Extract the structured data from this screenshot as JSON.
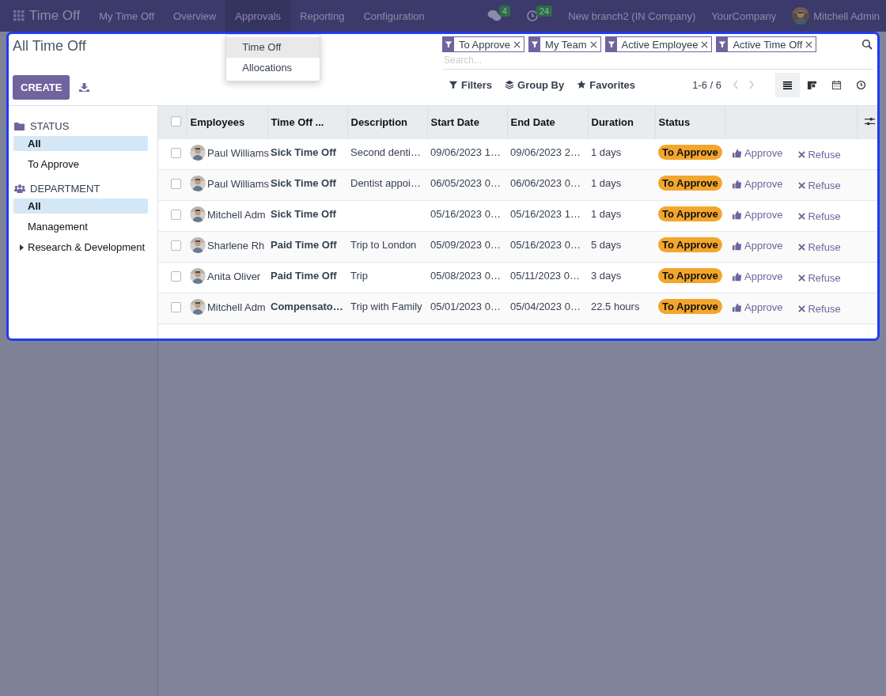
{
  "navbar": {
    "app_name": "Time Off",
    "menu": [
      {
        "label": "My Time Off",
        "selected": false
      },
      {
        "label": "Overview",
        "selected": false
      },
      {
        "label": "Approvals",
        "selected": true
      },
      {
        "label": "Reporting",
        "selected": false
      },
      {
        "label": "Configuration",
        "selected": false
      }
    ],
    "messages_count": "4",
    "activities_count": "24",
    "companies": [
      "New branch2 (IN Company)",
      "YourCompany"
    ],
    "user": "Mitchell Admin"
  },
  "approvals_menu": {
    "items": [
      {
        "label": "Time Off",
        "selected": true
      },
      {
        "label": "Allocations",
        "selected": false
      }
    ]
  },
  "control_panel": {
    "title": "All Time Off",
    "create_button": "CREATE",
    "facets": [
      {
        "label": "To Approve"
      },
      {
        "label": "My Team"
      },
      {
        "label": "Active Employee"
      },
      {
        "label": "Active Time Off"
      }
    ],
    "search_placeholder": "Search...",
    "filters": "Filters",
    "group_by": "Group By",
    "favorites": "Favorites",
    "pager": "1-6 / 6",
    "views": [
      {
        "kind": "list",
        "selected": true
      },
      {
        "kind": "kanban",
        "selected": false
      },
      {
        "kind": "calendar",
        "selected": false
      },
      {
        "kind": "activity",
        "selected": false
      }
    ]
  },
  "sidebar": {
    "sections": [
      {
        "kind": "status",
        "title": "STATUS",
        "items": [
          {
            "label": "All",
            "selected": true,
            "kind": "leaf"
          },
          {
            "label": "To Approve",
            "selected": false,
            "kind": "leaf"
          }
        ]
      },
      {
        "kind": "department",
        "title": "DEPARTMENT",
        "items": [
          {
            "label": "All",
            "selected": true,
            "kind": "leaf"
          },
          {
            "label": "Management",
            "selected": false,
            "kind": "leaf"
          },
          {
            "label": "Research & Development",
            "selected": false,
            "kind": "collapsed"
          }
        ]
      }
    ]
  },
  "table": {
    "select_all_checked": false,
    "columns": [
      "Employees",
      "Time Off ...",
      "Description",
      "Start Date",
      "End Date",
      "Duration",
      "Status"
    ],
    "rows": [
      {
        "checked": false,
        "employee": "Paul Williams",
        "type": "Sick Time Off",
        "description": "Second denti…",
        "start": "09/06/2023 1…",
        "end": "09/06/2023 2…",
        "duration": "1 days",
        "status": "To Approve",
        "approve": "Approve",
        "refuse": "Refuse"
      },
      {
        "checked": false,
        "employee": "Paul Williams",
        "type": "Sick Time Off",
        "description": "Dentist appoi…",
        "start": "06/05/2023 0…",
        "end": "06/06/2023 0…",
        "duration": "1 days",
        "status": "To Approve",
        "approve": "Approve",
        "refuse": "Refuse"
      },
      {
        "checked": false,
        "employee": "Mitchell Adm",
        "type": "Sick Time Off",
        "start": "05/16/2023 0…",
        "end": "05/16/2023 1…",
        "duration": "1 days",
        "status": "To Approve",
        "approve": "Approve",
        "refuse": "Refuse"
      },
      {
        "checked": false,
        "employee": "Sharlene Rh",
        "type": "Paid Time Off",
        "description": "Trip to London",
        "start": "05/09/2023 0…",
        "end": "05/16/2023 0…",
        "duration": "5 days",
        "status": "To Approve",
        "approve": "Approve",
        "refuse": "Refuse"
      },
      {
        "checked": false,
        "employee": "Anita Oliver",
        "type": "Paid Time Off",
        "description": "Trip",
        "start": "05/08/2023 0…",
        "end": "05/11/2023 0…",
        "duration": "3 days",
        "status": "To Approve",
        "approve": "Approve",
        "refuse": "Refuse"
      },
      {
        "checked": false,
        "employee": "Mitchell Adm",
        "type": "Compensato…",
        "description": "Trip with Family",
        "start": "05/01/2023 0…",
        "end": "05/04/2023 0…",
        "duration": "22.5 hours",
        "status": "To Approve",
        "approve": "Approve",
        "refuse": "Refuse"
      }
    ]
  }
}
